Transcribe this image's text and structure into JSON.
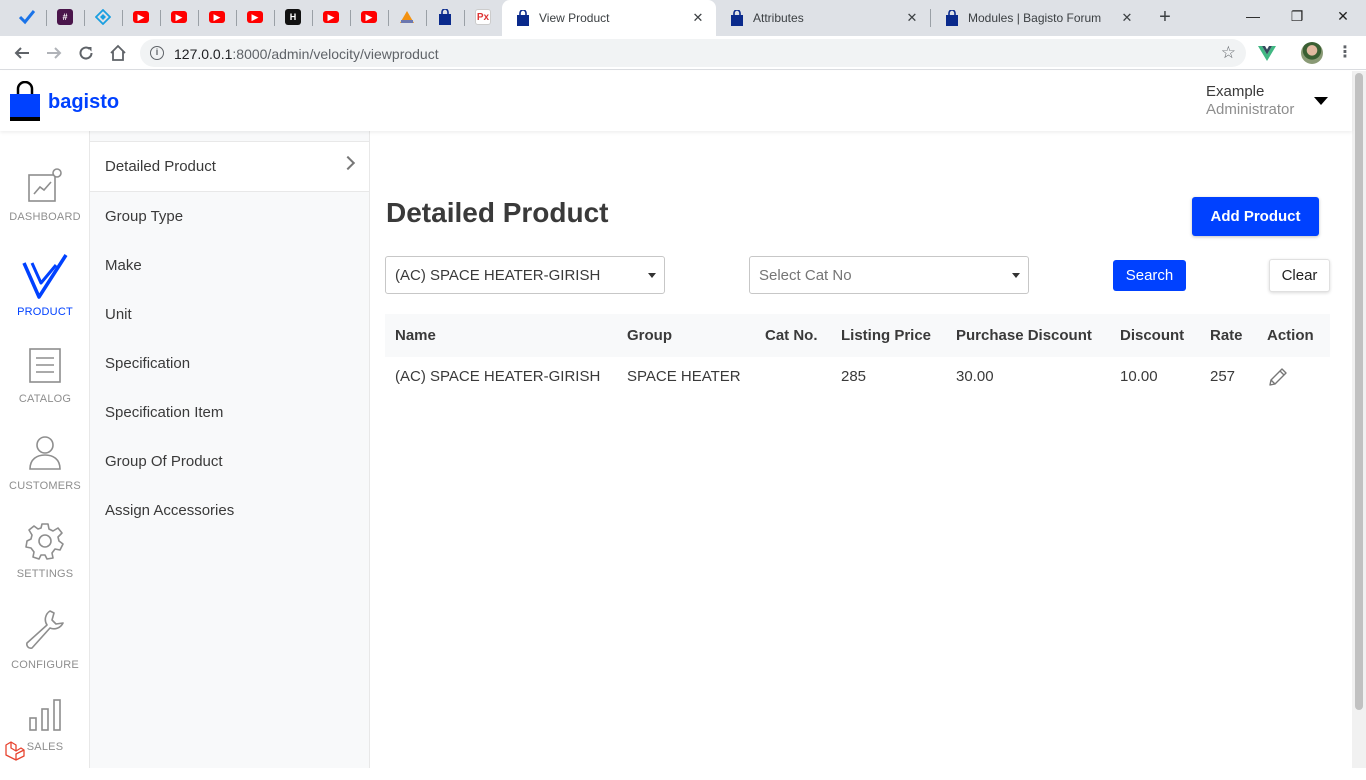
{
  "browser": {
    "pinned_tabs": [
      "check-icon",
      "slack-icon",
      "lens-icon",
      "youtube-icon",
      "youtube-icon",
      "youtube-icon",
      "youtube-icon",
      "hackernoon-icon",
      "youtube-icon",
      "youtube-icon",
      "pma-icon",
      "bagisto-icon",
      "px-icon"
    ],
    "tabs": [
      {
        "title": "View Product",
        "active": true
      },
      {
        "title": "Attributes",
        "active": false
      },
      {
        "title": "Modules | Bagisto Forum",
        "active": false
      }
    ],
    "url_host": "127.0.0.1",
    "url_rest": ":8000/admin/velocity/viewproduct"
  },
  "header": {
    "logo_text": "bagisto",
    "user_name": "Example",
    "user_role": "Administrator"
  },
  "nav": {
    "items": [
      {
        "label": "DASHBOARD",
        "icon": "dashboard-icon",
        "active": false
      },
      {
        "label": "PRODUCT",
        "icon": "product-icon",
        "active": true
      },
      {
        "label": "CATALOG",
        "icon": "catalog-icon",
        "active": false
      },
      {
        "label": "CUSTOMERS",
        "icon": "customers-icon",
        "active": false
      },
      {
        "label": "SETTINGS",
        "icon": "settings-icon",
        "active": false
      },
      {
        "label": "CONFIGURE",
        "icon": "configure-icon",
        "active": false
      },
      {
        "label": "SALES",
        "icon": "sales-icon",
        "active": false
      }
    ]
  },
  "submenu": {
    "items": [
      {
        "label": "Detailed Product",
        "active": true
      },
      {
        "label": "Group Type",
        "active": false
      },
      {
        "label": "Make",
        "active": false
      },
      {
        "label": "Unit",
        "active": false
      },
      {
        "label": "Specification",
        "active": false
      },
      {
        "label": "Specification Item",
        "active": false
      },
      {
        "label": "Group Of Product",
        "active": false
      },
      {
        "label": "Assign Accessories",
        "active": false
      }
    ]
  },
  "main": {
    "title": "Detailed Product",
    "add_button": "Add Product",
    "filters": {
      "product_value": "(AC) SPACE HEATER-GIRISH",
      "catno_placeholder": "Select Cat No",
      "search_button": "Search",
      "clear_button": "Clear"
    },
    "table": {
      "headers": [
        "Name",
        "Group",
        "Cat No.",
        "Listing Price",
        "Purchase Discount",
        "Discount",
        "Rate",
        "Action"
      ],
      "rows": [
        {
          "name": "(AC) SPACE HEATER-GIRISH",
          "group": "SPACE HEATER",
          "cat_no": "",
          "listing_price": "285",
          "purchase_discount": "30.00",
          "discount": "10.00",
          "rate": "257",
          "action": "edit-icon"
        }
      ]
    }
  },
  "colors": {
    "accent": "#0041ff",
    "text": "#3a3a3a",
    "muted": "#8e8e8e"
  }
}
